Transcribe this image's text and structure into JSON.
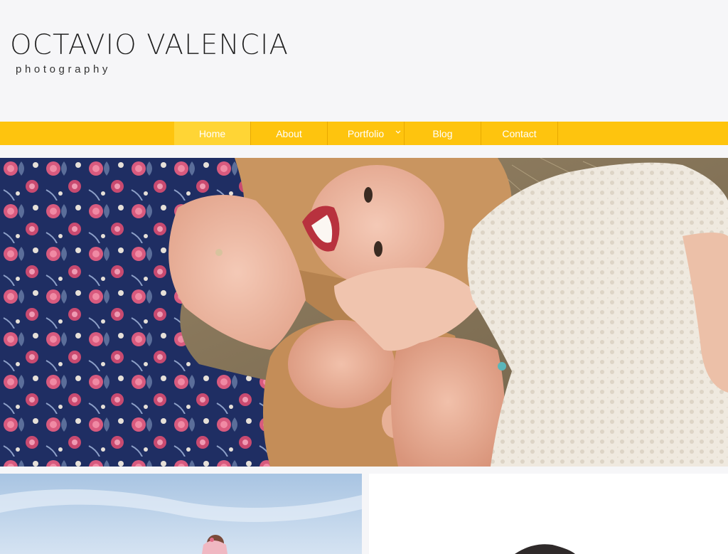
{
  "site": {
    "name": "OCTAVIO VALENCIA",
    "tagline": "photography"
  },
  "nav": {
    "items": [
      {
        "label": "Home",
        "active": true
      },
      {
        "label": "About"
      },
      {
        "label": "Portfolio",
        "has_dropdown": true
      },
      {
        "label": "Blog"
      },
      {
        "label": "Contact"
      }
    ]
  },
  "colors": {
    "background": "#f6f6f8",
    "nav_bar": "#fec40e",
    "nav_active": "#ffd535",
    "nav_text": "#ffffff",
    "logo_text": "#1a1a1a"
  },
  "images": {
    "hero": "hero-photo",
    "thumb_left": "gallery-thumbnail",
    "thumb_right": "gallery-thumbnail"
  }
}
